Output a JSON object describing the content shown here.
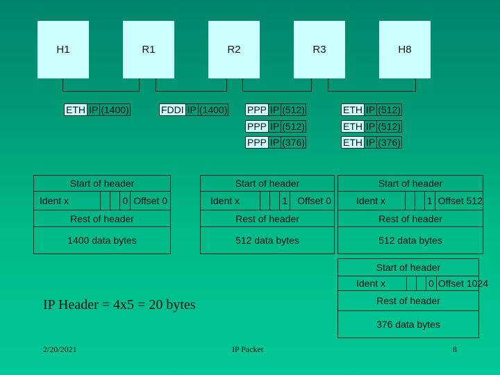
{
  "nodes": [
    "H1",
    "R1",
    "R2",
    "R3",
    "H8"
  ],
  "frames": [
    {
      "link": "ETH",
      "ip": "IP",
      "size": "(1400)"
    },
    {
      "link": "FDDI",
      "ip": "IP",
      "size": "(1400)"
    },
    {
      "link": "PPP",
      "ip": "IP",
      "size": "(512)"
    },
    {
      "link": "PPP",
      "ip": "IP",
      "size": "(512)"
    },
    {
      "link": "PPP",
      "ip": "IP",
      "size": "(376)"
    },
    {
      "link": "ETH",
      "ip": "IP",
      "size": "(512)"
    },
    {
      "link": "ETH",
      "ip": "IP",
      "size": "(512)"
    },
    {
      "link": "ETH",
      "ip": "IP",
      "size": "(376)"
    }
  ],
  "packets": [
    {
      "start": "Start of header",
      "ident": "Ident x",
      "flag": "0",
      "offset": "Offset 0",
      "rest": "Rest of header",
      "data": "1400 data bytes"
    },
    {
      "start": "Start of header",
      "ident": "Ident x",
      "flag": "1",
      "offset": "Offset 0",
      "rest": "Rest of header",
      "data": "512 data bytes"
    },
    {
      "start": "Start of header",
      "ident": "Ident x",
      "flag": "1",
      "offset": "Offset 512",
      "rest": "Rest of header",
      "data": "512 data bytes"
    },
    {
      "start": "Start of header",
      "ident": "Ident x",
      "flag": "0",
      "offset": "Offset 1024",
      "rest": "Rest of header",
      "data": "376 data bytes"
    }
  ],
  "note": "IP Header = 4x5 = 20 bytes",
  "footer": {
    "date": "2/20/2021",
    "title": "IP Packet",
    "page": "8"
  }
}
